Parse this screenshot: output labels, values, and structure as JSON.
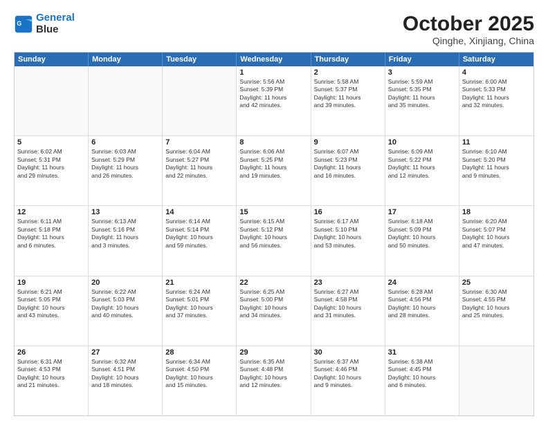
{
  "logo": {
    "line1": "General",
    "line2": "Blue"
  },
  "title": "October 2025",
  "subtitle": "Qinghe, Xinjiang, China",
  "days": [
    "Sunday",
    "Monday",
    "Tuesday",
    "Wednesday",
    "Thursday",
    "Friday",
    "Saturday"
  ],
  "weeks": [
    [
      {
        "day": "",
        "content": ""
      },
      {
        "day": "",
        "content": ""
      },
      {
        "day": "",
        "content": ""
      },
      {
        "day": "1",
        "content": "Sunrise: 5:56 AM\nSunset: 5:39 PM\nDaylight: 11 hours\nand 42 minutes."
      },
      {
        "day": "2",
        "content": "Sunrise: 5:58 AM\nSunset: 5:37 PM\nDaylight: 11 hours\nand 39 minutes."
      },
      {
        "day": "3",
        "content": "Sunrise: 5:59 AM\nSunset: 5:35 PM\nDaylight: 11 hours\nand 35 minutes."
      },
      {
        "day": "4",
        "content": "Sunrise: 6:00 AM\nSunset: 5:33 PM\nDaylight: 11 hours\nand 32 minutes."
      }
    ],
    [
      {
        "day": "5",
        "content": "Sunrise: 6:02 AM\nSunset: 5:31 PM\nDaylight: 11 hours\nand 29 minutes."
      },
      {
        "day": "6",
        "content": "Sunrise: 6:03 AM\nSunset: 5:29 PM\nDaylight: 11 hours\nand 26 minutes."
      },
      {
        "day": "7",
        "content": "Sunrise: 6:04 AM\nSunset: 5:27 PM\nDaylight: 11 hours\nand 22 minutes."
      },
      {
        "day": "8",
        "content": "Sunrise: 6:06 AM\nSunset: 5:25 PM\nDaylight: 11 hours\nand 19 minutes."
      },
      {
        "day": "9",
        "content": "Sunrise: 6:07 AM\nSunset: 5:23 PM\nDaylight: 11 hours\nand 16 minutes."
      },
      {
        "day": "10",
        "content": "Sunrise: 6:09 AM\nSunset: 5:22 PM\nDaylight: 11 hours\nand 12 minutes."
      },
      {
        "day": "11",
        "content": "Sunrise: 6:10 AM\nSunset: 5:20 PM\nDaylight: 11 hours\nand 9 minutes."
      }
    ],
    [
      {
        "day": "12",
        "content": "Sunrise: 6:11 AM\nSunset: 5:18 PM\nDaylight: 11 hours\nand 6 minutes."
      },
      {
        "day": "13",
        "content": "Sunrise: 6:13 AM\nSunset: 5:16 PM\nDaylight: 11 hours\nand 3 minutes."
      },
      {
        "day": "14",
        "content": "Sunrise: 6:14 AM\nSunset: 5:14 PM\nDaylight: 10 hours\nand 59 minutes."
      },
      {
        "day": "15",
        "content": "Sunrise: 6:15 AM\nSunset: 5:12 PM\nDaylight: 10 hours\nand 56 minutes."
      },
      {
        "day": "16",
        "content": "Sunrise: 6:17 AM\nSunset: 5:10 PM\nDaylight: 10 hours\nand 53 minutes."
      },
      {
        "day": "17",
        "content": "Sunrise: 6:18 AM\nSunset: 5:09 PM\nDaylight: 10 hours\nand 50 minutes."
      },
      {
        "day": "18",
        "content": "Sunrise: 6:20 AM\nSunset: 5:07 PM\nDaylight: 10 hours\nand 47 minutes."
      }
    ],
    [
      {
        "day": "19",
        "content": "Sunrise: 6:21 AM\nSunset: 5:05 PM\nDaylight: 10 hours\nand 43 minutes."
      },
      {
        "day": "20",
        "content": "Sunrise: 6:22 AM\nSunset: 5:03 PM\nDaylight: 10 hours\nand 40 minutes."
      },
      {
        "day": "21",
        "content": "Sunrise: 6:24 AM\nSunset: 5:01 PM\nDaylight: 10 hours\nand 37 minutes."
      },
      {
        "day": "22",
        "content": "Sunrise: 6:25 AM\nSunset: 5:00 PM\nDaylight: 10 hours\nand 34 minutes."
      },
      {
        "day": "23",
        "content": "Sunrise: 6:27 AM\nSunset: 4:58 PM\nDaylight: 10 hours\nand 31 minutes."
      },
      {
        "day": "24",
        "content": "Sunrise: 6:28 AM\nSunset: 4:56 PM\nDaylight: 10 hours\nand 28 minutes."
      },
      {
        "day": "25",
        "content": "Sunrise: 6:30 AM\nSunset: 4:55 PM\nDaylight: 10 hours\nand 25 minutes."
      }
    ],
    [
      {
        "day": "26",
        "content": "Sunrise: 6:31 AM\nSunset: 4:53 PM\nDaylight: 10 hours\nand 21 minutes."
      },
      {
        "day": "27",
        "content": "Sunrise: 6:32 AM\nSunset: 4:51 PM\nDaylight: 10 hours\nand 18 minutes."
      },
      {
        "day": "28",
        "content": "Sunrise: 6:34 AM\nSunset: 4:50 PM\nDaylight: 10 hours\nand 15 minutes."
      },
      {
        "day": "29",
        "content": "Sunrise: 6:35 AM\nSunset: 4:48 PM\nDaylight: 10 hours\nand 12 minutes."
      },
      {
        "day": "30",
        "content": "Sunrise: 6:37 AM\nSunset: 4:46 PM\nDaylight: 10 hours\nand 9 minutes."
      },
      {
        "day": "31",
        "content": "Sunrise: 6:38 AM\nSunset: 4:45 PM\nDaylight: 10 hours\nand 6 minutes."
      },
      {
        "day": "",
        "content": ""
      }
    ]
  ]
}
